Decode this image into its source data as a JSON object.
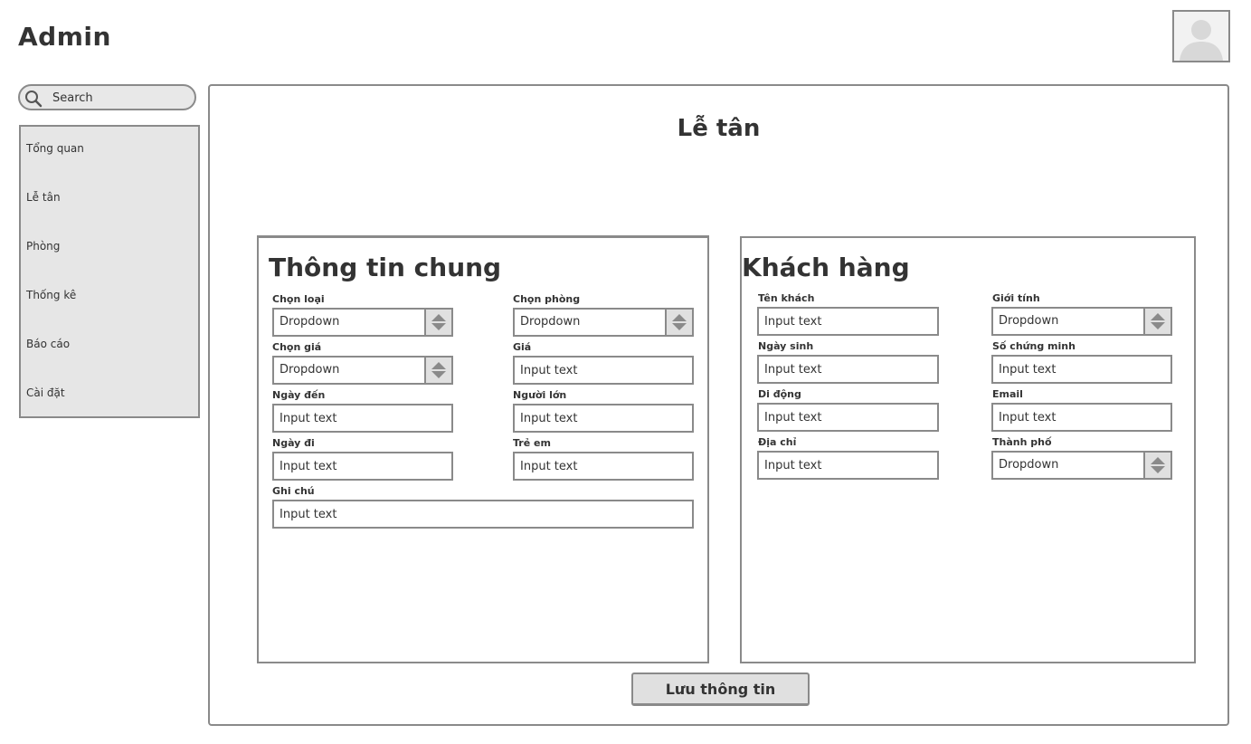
{
  "app": {
    "title": "Admin"
  },
  "search": {
    "placeholder": "Search"
  },
  "sidebar": {
    "items": [
      {
        "label": "Tổng quan"
      },
      {
        "label": "Lễ tân"
      },
      {
        "label": "Phòng"
      },
      {
        "label": "Thống kê"
      },
      {
        "label": "Báo cáo"
      },
      {
        "label": "Cài đặt"
      }
    ]
  },
  "main": {
    "title": "Lễ tân",
    "save_label": "Lưu thông tin",
    "general": {
      "title": "Thông tin chung",
      "fields": {
        "type": {
          "label": "Chọn loại",
          "value": "Dropdown"
        },
        "room": {
          "label": "Chọn phòng",
          "value": "Dropdown"
        },
        "rate": {
          "label": "Chọn giá",
          "value": "Dropdown"
        },
        "price": {
          "label": "Giá",
          "placeholder": "Input text"
        },
        "arrival": {
          "label": "Ngày đến",
          "placeholder": "Input text"
        },
        "adults": {
          "label": "Người lớn",
          "placeholder": "Input text"
        },
        "departure": {
          "label": "Ngày đi",
          "placeholder": "Input text"
        },
        "children": {
          "label": "Trẻ em",
          "placeholder": "Input text"
        },
        "note": {
          "label": "Ghi chú",
          "placeholder": "Input text"
        }
      }
    },
    "customer": {
      "title": "Khách hàng",
      "fields": {
        "name": {
          "label": "Tên khách",
          "placeholder": "Input text"
        },
        "gender": {
          "label": "Giới tính",
          "value": "Dropdown"
        },
        "birthday": {
          "label": "Ngày sinh",
          "placeholder": "Input text"
        },
        "id_number": {
          "label": "Số chứng minh",
          "placeholder": "Input text"
        },
        "mobile": {
          "label": "Di động",
          "placeholder": "Input text"
        },
        "email": {
          "label": "Email",
          "placeholder": "Input text"
        },
        "address": {
          "label": "Địa chỉ",
          "placeholder": "Input text"
        },
        "city": {
          "label": "Thành phố",
          "value": "Dropdown"
        }
      }
    }
  },
  "icons": {
    "avatar": "user-avatar-icon",
    "search": "search-icon",
    "dropdown": "updown-arrows-icon"
  },
  "colors": {
    "border": "#8a8a8a",
    "sidebar_bg": "#e6e6e6",
    "button_bg": "#e0e0e0",
    "text": "#333333"
  }
}
